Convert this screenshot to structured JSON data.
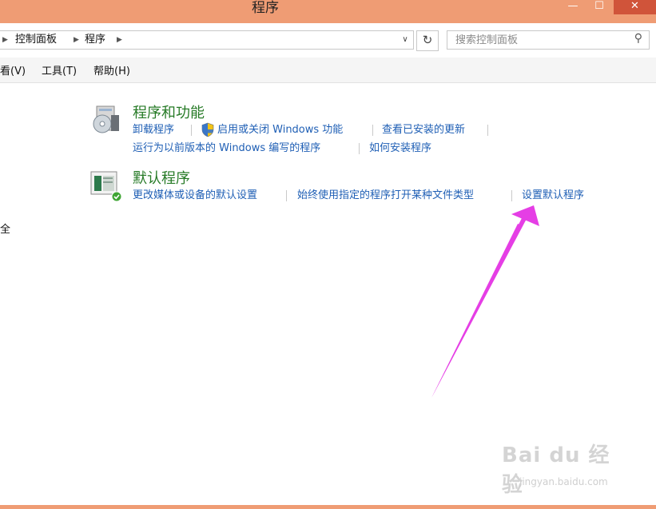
{
  "window": {
    "title": "程序",
    "min_label": "—",
    "max_label": "☐",
    "close_label": "✕"
  },
  "address": {
    "crumbs": [
      "控制面板",
      "程序"
    ],
    "dropdown_glyph": "∨",
    "refresh_glyph": "↻",
    "search_placeholder": "搜索控制面板",
    "search_glyph": "⚲"
  },
  "menubar": {
    "items": [
      "看(V)",
      "工具(T)",
      "帮助(H)"
    ]
  },
  "left_fragment": "全",
  "categories": [
    {
      "title": "程序和功能",
      "links": [
        "卸载程序",
        "启用或关闭 Windows 功能",
        "查看已安装的更新",
        "运行为以前版本的 Windows 编写的程序",
        "如何安装程序"
      ]
    },
    {
      "title": "默认程序",
      "links": [
        "更改媒体或设备的默认设置",
        "始终使用指定的程序打开某种文件类型",
        "设置默认程序"
      ]
    }
  ],
  "watermark": {
    "logo": "Bai du 经验",
    "url": "jingyan.baidu.com"
  },
  "colors": {
    "titlebar": "#ef9c74",
    "category_title": "#267a26",
    "link": "#1f5fb5",
    "arrow": "#e53ee5"
  }
}
